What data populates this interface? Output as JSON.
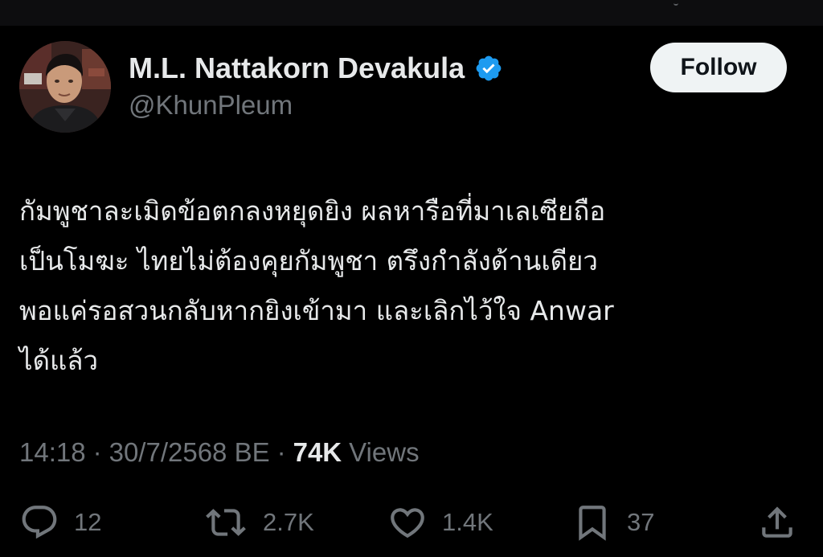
{
  "author": {
    "display_name": "M.L. Nattakorn Devakula",
    "handle": "@KhunPleum",
    "verified_icon": "verified-badge-icon",
    "follow_label": "Follow"
  },
  "tweet": {
    "lines": [
      "กัมพูชาละเมิดข้อตกลงหยุดยิง ผลหารือที่มาเลเซียถือ",
      "เป็นโมฆะ ไทยไม่ต้องคุยกัมพูชา ตรึงกำลังด้านเดียว",
      "พอแค่รอสวนกลับหากยิงเข้ามา และเลิกไว้ใจ Anwar",
      "ได้แล้ว"
    ]
  },
  "meta": {
    "time": "14:18",
    "separator": "·",
    "date": "30/7/2568 BE",
    "views_count": "74K",
    "views_label": "Views"
  },
  "actions": {
    "reply": {
      "icon": "reply-icon",
      "count": "12"
    },
    "repost": {
      "icon": "repost-icon",
      "count": "2.7K"
    },
    "like": {
      "icon": "heart-icon",
      "count": "1.4K"
    },
    "bookmark": {
      "icon": "bookmark-icon",
      "count": "37"
    },
    "share": {
      "icon": "share-icon"
    }
  },
  "colors": {
    "background": "#000000",
    "primary_text": "#e7e9ea",
    "secondary_text": "#71767b",
    "verified_blue": "#1d9bf0",
    "follow_bg": "#eff3f4"
  }
}
